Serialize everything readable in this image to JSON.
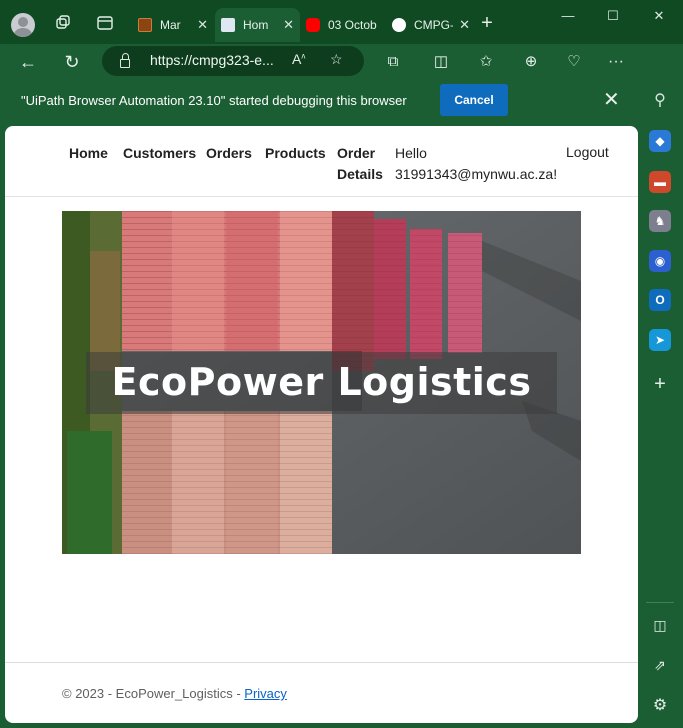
{
  "browser": {
    "tabs": [
      {
        "title": "Mar",
        "favicon_color": "#8b4513"
      },
      {
        "title": "Hom",
        "favicon_color": "#dfe8f2"
      },
      {
        "title": "03 Octob",
        "favicon_color": "#ff0000"
      },
      {
        "title": "CMPG-P",
        "favicon_color": "#ffffff"
      }
    ],
    "address": {
      "url": "https://cmpg323-e..."
    },
    "bing_label": "b"
  },
  "infobar": {
    "message": "\"UiPath Browser Automation 23.10\" started debugging this browser",
    "cancel_label": "Cancel"
  },
  "site": {
    "nav": {
      "home": "Home",
      "customers": "Customers",
      "orders": "Orders",
      "products": "Products",
      "order_details_line1": "Order",
      "order_details_line2": "Details",
      "hello_line1": "Hello",
      "hello_line2": "31991343@mynwu.ac.za!",
      "logout": "Logout"
    },
    "hero_title": "EcoPower Logistics",
    "footer": {
      "copyright": "© 2023 - EcoPower_Logistics - ",
      "privacy_link": "Privacy"
    }
  },
  "colors": {
    "chrome_dark": "#0f4a22",
    "chrome": "#1b5e34",
    "accent_blue": "#0f6cbd"
  }
}
